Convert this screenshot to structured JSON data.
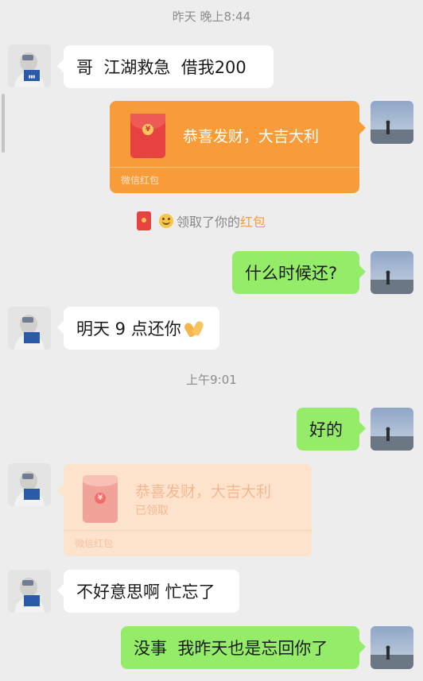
{
  "timestamps": {
    "first": "昨天 晚上8:44",
    "second": "上午9:01"
  },
  "messages": {
    "m1": "哥  江湖救急  借我200",
    "m2": "什么时候还?",
    "m3": "明天 9 点还你",
    "m4": "好的",
    "m5": "不好意思啊 忙忘了",
    "m6": "没事  我昨天也是忘回你了"
  },
  "red_packet_sent": {
    "title": "恭喜发财，大吉大利",
    "footer": "微信红包"
  },
  "red_packet_received": {
    "title": "恭喜发财，大吉大利",
    "status": "已领取",
    "footer": "微信红包"
  },
  "notice": {
    "prefix": "领取了你的",
    "highlight": "红包"
  },
  "emoji": {
    "smile": "smile-emoji",
    "clap": "clap-emoji"
  },
  "colors": {
    "bg": "#ededed",
    "green_bubble": "#95ec69",
    "white_bubble": "#ffffff",
    "red_packet": "#f79c38",
    "red_packet_opened": "#fde3cc"
  }
}
